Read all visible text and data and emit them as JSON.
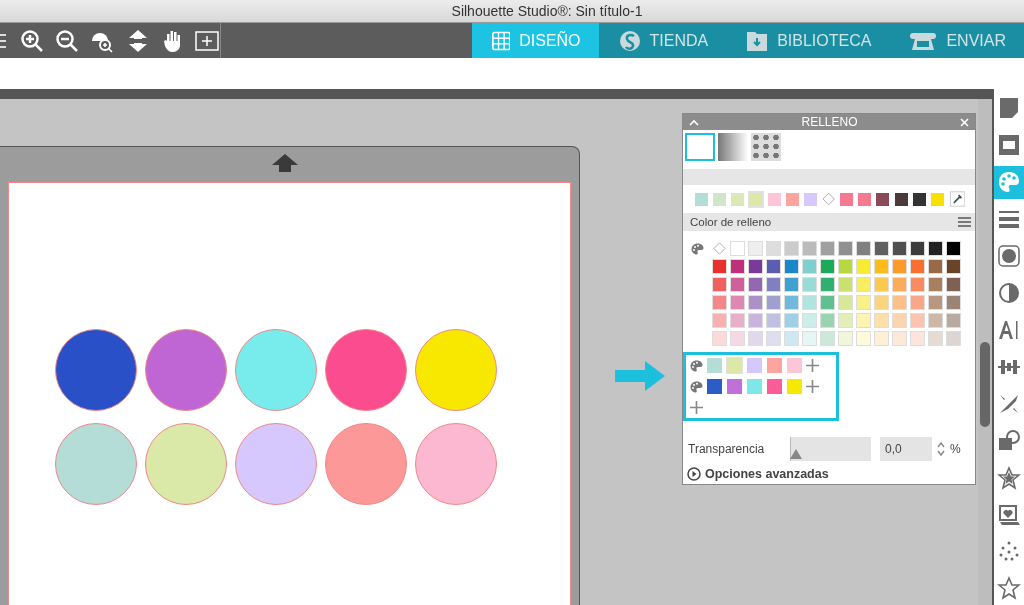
{
  "window": {
    "title": "Silhouette Studio®: Sin título-1"
  },
  "tabs": [
    {
      "label": "DISEÑO",
      "selected": true
    },
    {
      "label": "TIENDA",
      "selected": false
    },
    {
      "label": "BIBLIOTECA",
      "selected": false
    },
    {
      "label": "ENVIAR",
      "selected": false
    }
  ],
  "circles": [
    {
      "color": "#2a50c8"
    },
    {
      "color": "#c066d4"
    },
    {
      "color": "#78ecec"
    },
    {
      "color": "#fc4c90"
    },
    {
      "color": "#f8e800"
    },
    {
      "color": "#b3ddd6"
    },
    {
      "color": "#dae8a8"
    },
    {
      "color": "#d6c8fc"
    },
    {
      "color": "#fc9898"
    },
    {
      "color": "#fcb8d0"
    }
  ],
  "panel": {
    "title": "RELLENO",
    "fill_types": [
      {
        "kind": "solid",
        "selected": true
      },
      {
        "kind": "gradient",
        "selected": false
      },
      {
        "kind": "pattern",
        "selected": false
      }
    ],
    "recent": [
      {
        "kind": "swatch",
        "color": "#b3ddd6",
        "selected": false
      },
      {
        "kind": "swatch",
        "color": "#cfe6c8",
        "selected": false
      },
      {
        "kind": "swatch",
        "color": "#dde8b8",
        "selected": false
      },
      {
        "kind": "swatch",
        "color": "#dde8a8",
        "selected": true
      },
      {
        "kind": "swatch",
        "color": "#fcc6d8",
        "selected": false
      },
      {
        "kind": "swatch",
        "color": "#fca4a0",
        "selected": false
      },
      {
        "kind": "swatch",
        "color": "#d6c8fc",
        "selected": false
      },
      {
        "kind": "none",
        "selected": false
      },
      {
        "kind": "swatch",
        "color": "#f57a90",
        "selected": false
      },
      {
        "kind": "swatch",
        "color": "#f57a90",
        "selected": false
      },
      {
        "kind": "swatch",
        "color": "#8a4a5a",
        "selected": false
      },
      {
        "kind": "swatch",
        "color": "#4a3a3a",
        "selected": false
      },
      {
        "kind": "swatch",
        "color": "#333333",
        "selected": false
      },
      {
        "kind": "swatch",
        "color": "#f9e000",
        "selected": false
      }
    ],
    "section_title": "Color de relleno",
    "grid": [
      [
        {
          "kind": "none"
        },
        {
          "kind": "swatch",
          "color": "#ffffff"
        },
        {
          "kind": "swatch",
          "color": "#eeeeee"
        },
        {
          "kind": "swatch",
          "color": "#dddddd"
        },
        {
          "kind": "swatch",
          "color": "#cccccc"
        },
        {
          "kind": "swatch",
          "color": "#bbbbbb"
        },
        {
          "kind": "swatch",
          "color": "#a0a0a0"
        },
        {
          "kind": "swatch",
          "color": "#909090"
        },
        {
          "kind": "swatch",
          "color": "#808080"
        },
        {
          "kind": "swatch",
          "color": "#606060"
        },
        {
          "kind": "swatch",
          "color": "#505050"
        },
        {
          "kind": "swatch",
          "color": "#3c3c3c"
        },
        {
          "kind": "swatch",
          "color": "#222222"
        },
        {
          "kind": "swatch",
          "color": "#000000"
        }
      ],
      [
        {
          "kind": "swatch",
          "color": "#e8302e"
        },
        {
          "kind": "swatch",
          "color": "#c0307a"
        },
        {
          "kind": "swatch",
          "color": "#7a3a9a"
        },
        {
          "kind": "swatch",
          "color": "#5c5cb0"
        },
        {
          "kind": "swatch",
          "color": "#1a88c8"
        },
        {
          "kind": "swatch",
          "color": "#7ed0cc"
        },
        {
          "kind": "swatch",
          "color": "#1aaa5a"
        },
        {
          "kind": "swatch",
          "color": "#b8d840"
        },
        {
          "kind": "swatch",
          "color": "#f8ec30"
        },
        {
          "kind": "swatch",
          "color": "#fcbc1a"
        },
        {
          "kind": "swatch",
          "color": "#fc9a2a"
        },
        {
          "kind": "swatch",
          "color": "#f87030"
        },
        {
          "kind": "swatch",
          "color": "#9a6a48"
        },
        {
          "kind": "swatch",
          "color": "#6a4428"
        }
      ],
      [
        {
          "kind": "swatch",
          "color": "#f06060"
        },
        {
          "kind": "swatch",
          "color": "#d0609a"
        },
        {
          "kind": "swatch",
          "color": "#9468b0"
        },
        {
          "kind": "swatch",
          "color": "#8080c0"
        },
        {
          "kind": "swatch",
          "color": "#40a0d0"
        },
        {
          "kind": "swatch",
          "color": "#98dcd6"
        },
        {
          "kind": "swatch",
          "color": "#30b070"
        },
        {
          "kind": "swatch",
          "color": "#cce070"
        },
        {
          "kind": "swatch",
          "color": "#f8ee60"
        },
        {
          "kind": "swatch",
          "color": "#fcc850"
        },
        {
          "kind": "swatch",
          "color": "#fcac58"
        },
        {
          "kind": "swatch",
          "color": "#f88c60"
        },
        {
          "kind": "swatch",
          "color": "#a88060"
        },
        {
          "kind": "swatch",
          "color": "#806050"
        }
      ],
      [
        {
          "kind": "swatch",
          "color": "#f48888"
        },
        {
          "kind": "swatch",
          "color": "#dc88b0"
        },
        {
          "kind": "swatch",
          "color": "#ac90c8"
        },
        {
          "kind": "swatch",
          "color": "#a0a0d0"
        },
        {
          "kind": "swatch",
          "color": "#70b8dc"
        },
        {
          "kind": "swatch",
          "color": "#b0e4de"
        },
        {
          "kind": "swatch",
          "color": "#60c090"
        },
        {
          "kind": "swatch",
          "color": "#d8e898"
        },
        {
          "kind": "swatch",
          "color": "#faf088"
        },
        {
          "kind": "swatch",
          "color": "#fcd480"
        },
        {
          "kind": "swatch",
          "color": "#fcc088"
        },
        {
          "kind": "swatch",
          "color": "#f8a888"
        },
        {
          "kind": "swatch",
          "color": "#b89880"
        },
        {
          "kind": "swatch",
          "color": "#9c8474"
        }
      ],
      [
        {
          "kind": "swatch",
          "color": "#f8b0b0"
        },
        {
          "kind": "swatch",
          "color": "#e8b0c8"
        },
        {
          "kind": "swatch",
          "color": "#c8b4dc"
        },
        {
          "kind": "swatch",
          "color": "#c0c0e0"
        },
        {
          "kind": "swatch",
          "color": "#a0d0e8"
        },
        {
          "kind": "swatch",
          "color": "#cceee8"
        },
        {
          "kind": "swatch",
          "color": "#98d4b0"
        },
        {
          "kind": "swatch",
          "color": "#e4eeb8"
        },
        {
          "kind": "swatch",
          "color": "#fcf4b0"
        },
        {
          "kind": "swatch",
          "color": "#fce0a8"
        },
        {
          "kind": "swatch",
          "color": "#fcd4b0"
        },
        {
          "kind": "swatch",
          "color": "#fcc4b0"
        },
        {
          "kind": "swatch",
          "color": "#ccb8a8"
        },
        {
          "kind": "swatch",
          "color": "#b8aaa0"
        }
      ],
      [
        {
          "kind": "swatch",
          "color": "#fcdada"
        },
        {
          "kind": "swatch",
          "color": "#f4d8e4"
        },
        {
          "kind": "swatch",
          "color": "#e0d8ec"
        },
        {
          "kind": "swatch",
          "color": "#dedeee"
        },
        {
          "kind": "swatch",
          "color": "#d0e8f4"
        },
        {
          "kind": "swatch",
          "color": "#e6f6f4"
        },
        {
          "kind": "swatch",
          "color": "#cce8d8"
        },
        {
          "kind": "swatch",
          "color": "#f0f6dc"
        },
        {
          "kind": "swatch",
          "color": "#fefadc"
        },
        {
          "kind": "swatch",
          "color": "#fef0d8"
        },
        {
          "kind": "swatch",
          "color": "#fee8d8"
        },
        {
          "kind": "swatch",
          "color": "#fde4dc"
        },
        {
          "kind": "swatch",
          "color": "#e4dcd4"
        },
        {
          "kind": "swatch",
          "color": "#dcd6d2"
        }
      ]
    ],
    "custom_palettes": [
      {
        "swatches": [
          {
            "color": "#b3ddd6",
            "selected": false
          },
          {
            "color": "#dde8a8",
            "selected": true
          },
          {
            "color": "#d6c8fc",
            "selected": false
          },
          {
            "color": "#fca4a0",
            "selected": false
          },
          {
            "color": "#fcc6d8",
            "selected": false
          }
        ]
      },
      {
        "swatches": [
          {
            "color": "#2c5cc8",
            "selected": false
          },
          {
            "color": "#c070d8",
            "selected": false
          },
          {
            "color": "#7ee8e8",
            "selected": false
          },
          {
            "color": "#fc5c98",
            "selected": false
          },
          {
            "color": "#f8e800",
            "selected": false
          }
        ]
      }
    ],
    "transparency": {
      "label": "Transparencia",
      "level": 0,
      "value": "0,0",
      "unit": "%"
    },
    "advanced": {
      "label": "Opciones avanzadas",
      "expanded": false
    }
  },
  "sidebar": [
    {
      "selected": false
    },
    {
      "selected": false
    },
    {
      "selected": true
    },
    {
      "selected": false
    },
    {
      "selected": false
    },
    {
      "selected": false
    },
    {
      "selected": false
    },
    {
      "selected": false
    },
    {
      "selected": false
    },
    {
      "selected": false
    },
    {
      "selected": false
    },
    {
      "selected": false
    },
    {
      "selected": false
    },
    {
      "selected": false
    }
  ]
}
